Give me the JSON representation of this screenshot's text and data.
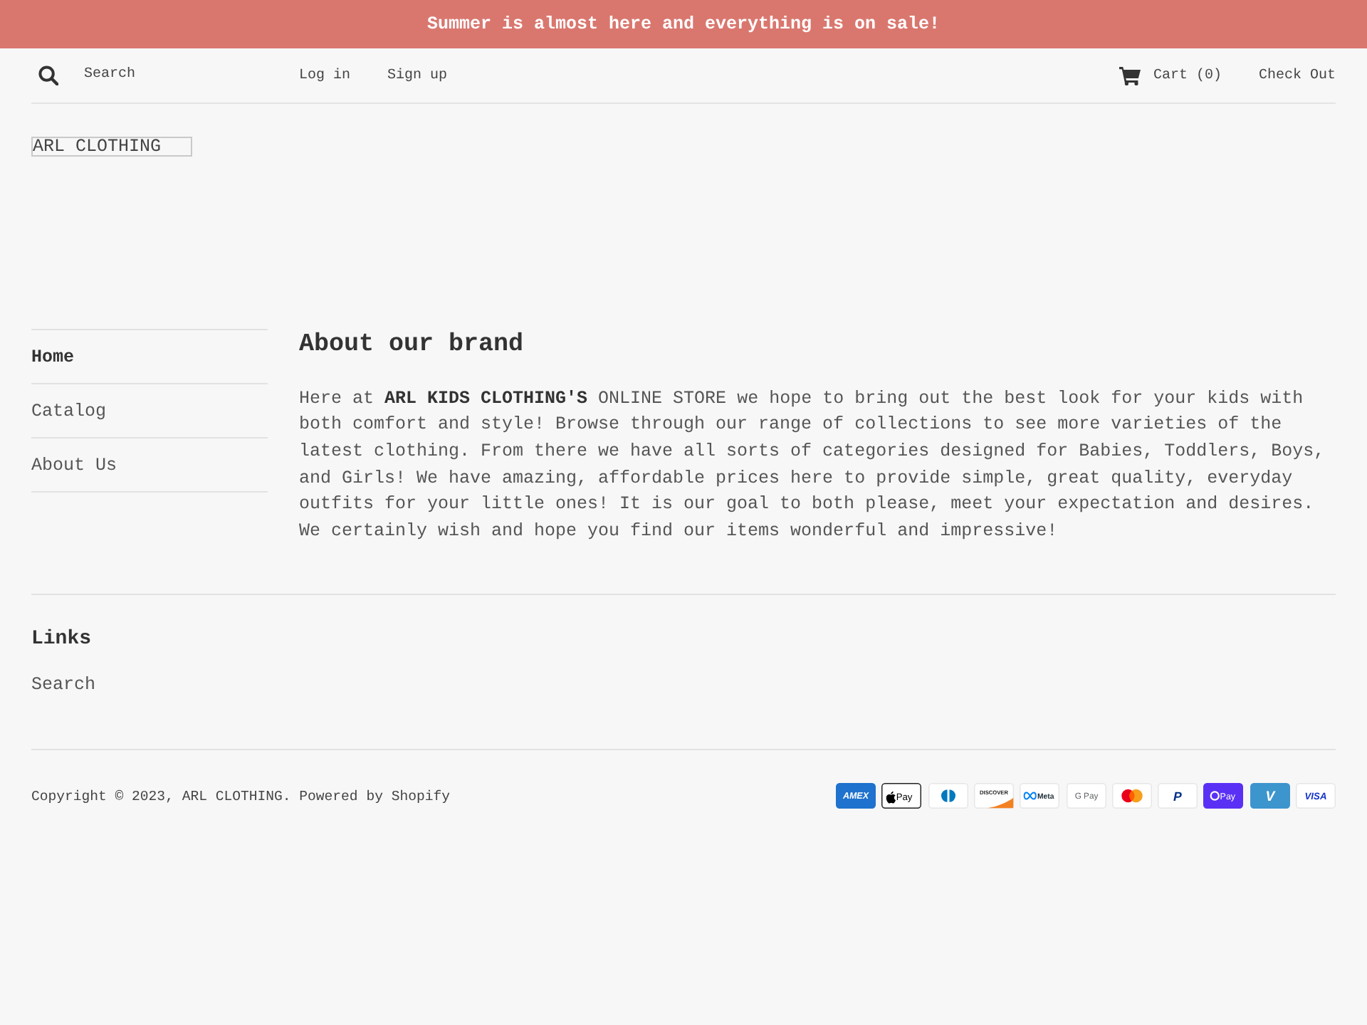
{
  "announcement": {
    "text": "Summer is almost here and everything is on sale!"
  },
  "header": {
    "search": {
      "placeholder": "Search"
    },
    "log_in": {
      "label": "Log in"
    },
    "sign_up": {
      "label": "Sign up"
    },
    "cart": {
      "label": "Cart (0)"
    },
    "check_out": {
      "label": "Check Out"
    }
  },
  "logo": {
    "text": "ARL CLOTHING"
  },
  "sidebar": {
    "items": [
      {
        "label": "Home",
        "selected": true
      },
      {
        "label": "Catalog",
        "selected": false
      },
      {
        "label": "About Us",
        "selected": false
      }
    ]
  },
  "page": {
    "title": "About our brand",
    "body": "Here at **ARL KIDS CLOTHING'S** ONLINE STORE we hope to bring out the best look for your kids with both comfort and style! Browse through our range of collections to see more varieties of the latest clothing. From there we have all sorts of categories designed for Babies, Toddlers, Boys, and Girls! We have amazing, affordable prices here to provide simple, great quality, everyday outfits for your little ones! It is our goal to both please, meet your expectation and desires. We certainly wish and hope you find our items wonderful and impressive!"
  },
  "footer": {
    "links_title": "Links",
    "links": [
      {
        "label": "Search"
      }
    ],
    "copyright": {
      "prefix": "Copyright © 2023,",
      "store_link": "ARL CLOTHING",
      "separator": ".",
      "powered_by": "Powered by Shopify"
    },
    "payment_icons": [
      {
        "kind": "amex",
        "label": "AMEX"
      },
      {
        "kind": "apple_pay",
        "label": "Pay"
      },
      {
        "kind": "diners"
      },
      {
        "kind": "discover",
        "label": "DISCOVER"
      },
      {
        "kind": "meta_pay",
        "label": "Meta"
      },
      {
        "kind": "google_pay",
        "label": "G Pay"
      },
      {
        "kind": "mastercard"
      },
      {
        "kind": "paypal",
        "label": "P"
      },
      {
        "kind": "shop_pay",
        "label": "Pay"
      },
      {
        "kind": "venmo",
        "label": "V"
      },
      {
        "kind": "visa",
        "label": "VISA"
      }
    ]
  }
}
